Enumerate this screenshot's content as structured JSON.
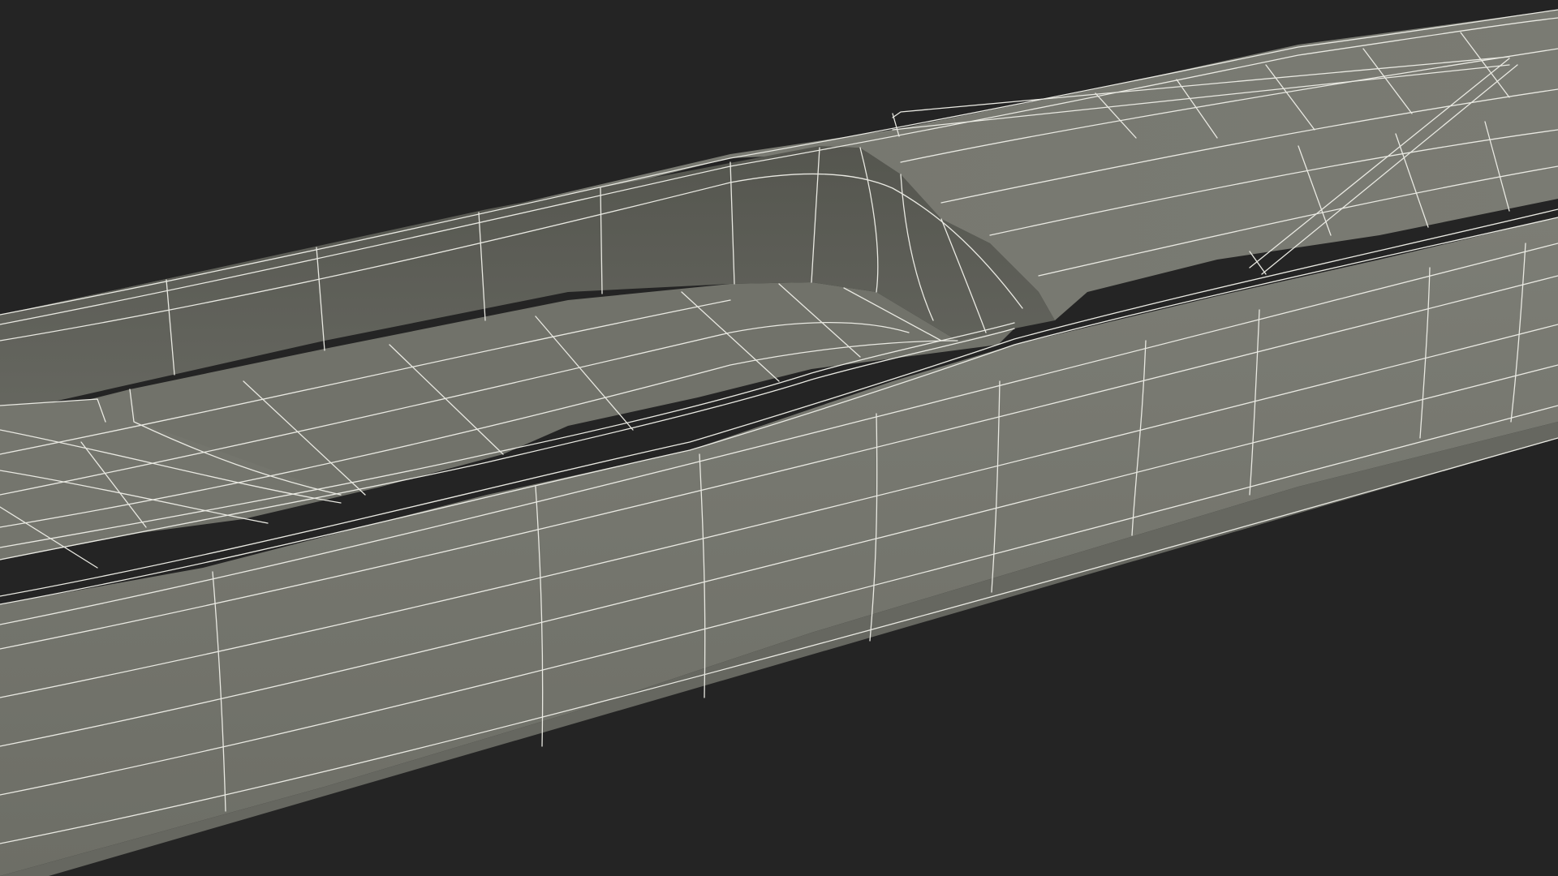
{
  "scene": {
    "subject": "",
    "render_style": "wireframe",
    "colors": {
      "background": "#242424",
      "hull_side": "#777870",
      "hull_side_dark": "#6a6b63",
      "deck_top": "#74756c",
      "cockpit_wall": "#5e5f57",
      "cockpit_floor": "#6e6f67",
      "wireframe": "#e9e9e2"
    }
  }
}
